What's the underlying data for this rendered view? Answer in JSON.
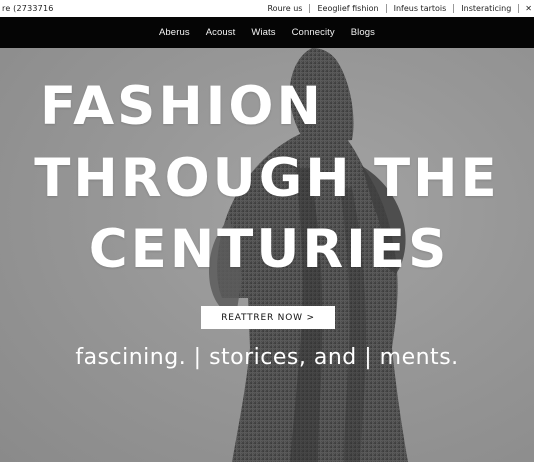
{
  "util_bar": {
    "left_text": "re (2733716",
    "links": [
      "Roure us",
      "Eeoglief fishion",
      "Infeus tartois",
      "Insteraticing"
    ],
    "icon": "close-icon",
    "icon_glyph": "✕"
  },
  "nav": {
    "items": [
      "Aberus",
      "Acoust",
      "Wiats",
      "Connecity",
      "Blogs"
    ]
  },
  "hero": {
    "headline_line1": "FASHION",
    "headline_line2": "THROUGH THE",
    "headline_line3": "CENTURIES",
    "cta_label": "REATTRER NOW >",
    "tagline": "fascining. | storices, and | ments."
  },
  "colors": {
    "nav_background": "#050505",
    "hero_background": "#979797",
    "text_light": "#ffffff"
  }
}
